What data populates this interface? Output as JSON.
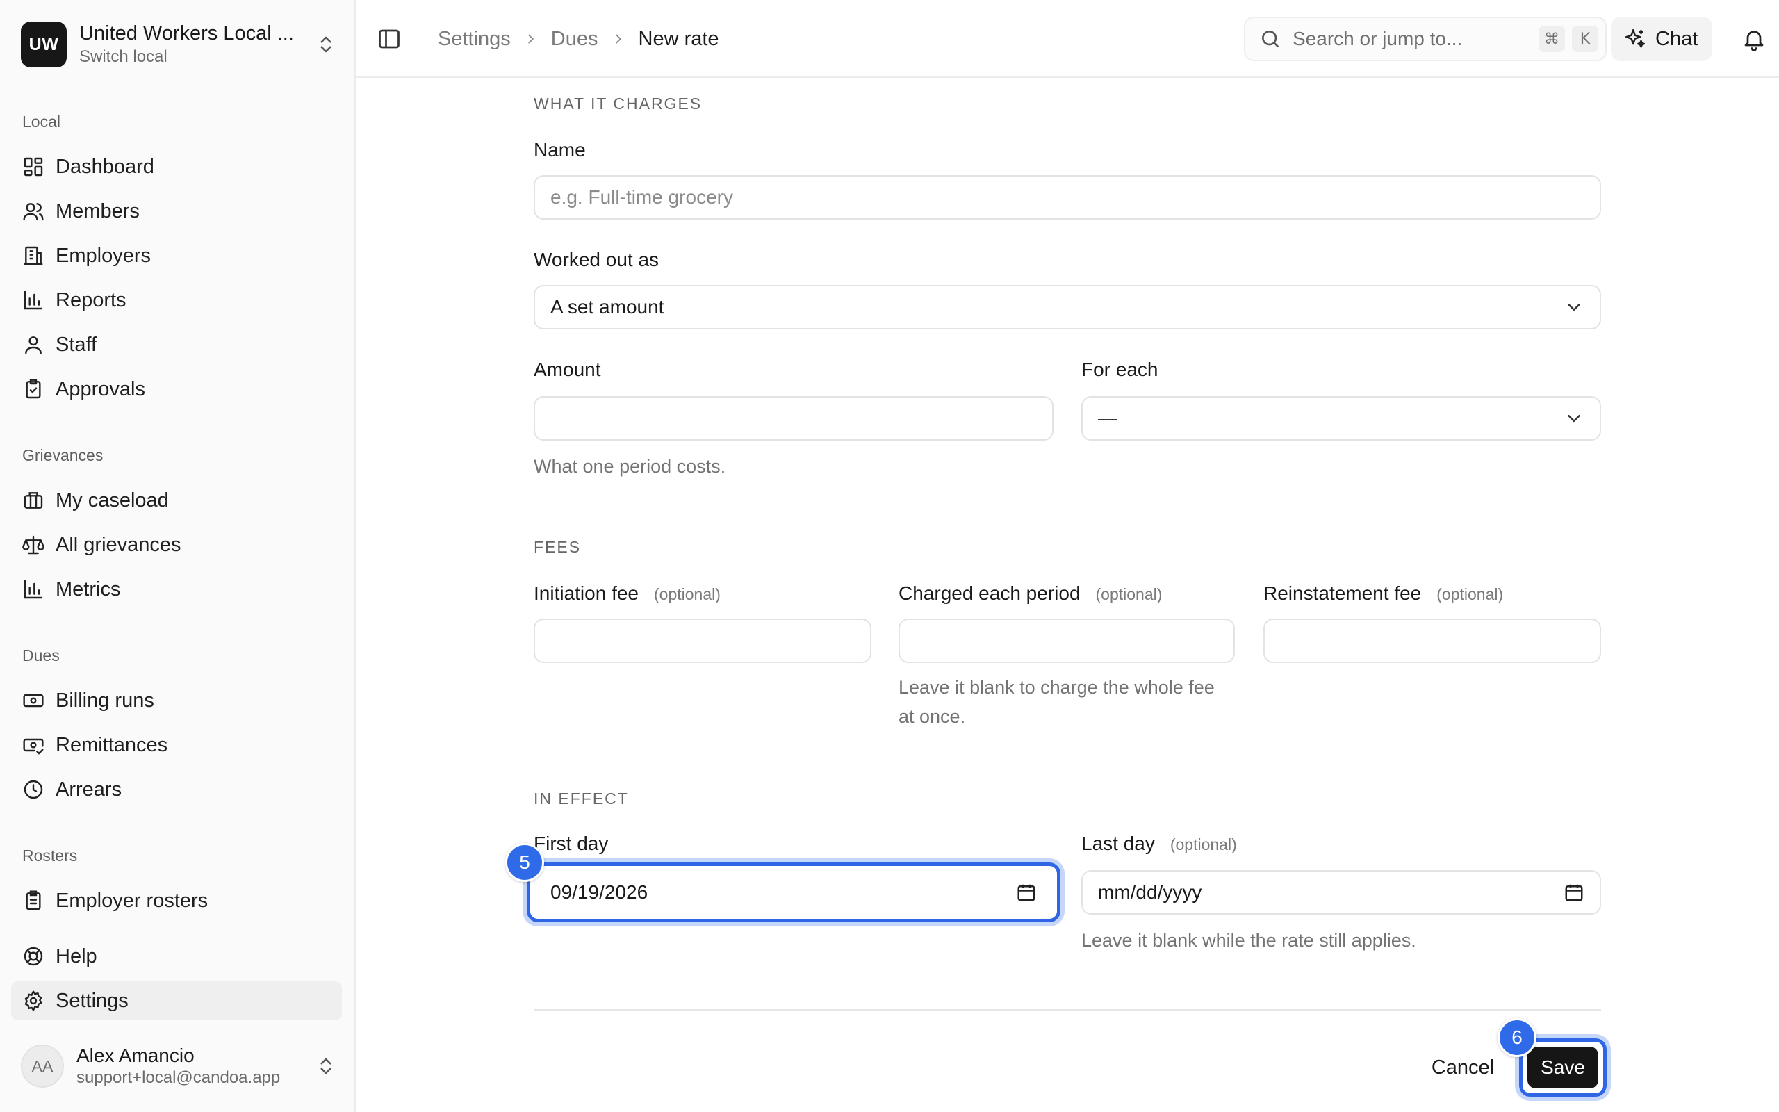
{
  "org": {
    "initials": "UW",
    "name": "United Workers Local ...",
    "subtitle": "Switch local"
  },
  "sidebar": {
    "sections": [
      {
        "label": "Local",
        "items": [
          "Dashboard",
          "Members",
          "Employers",
          "Reports",
          "Staff",
          "Approvals"
        ]
      },
      {
        "label": "Grievances",
        "items": [
          "My caseload",
          "All grievances",
          "Metrics"
        ]
      },
      {
        "label": "Dues",
        "items": [
          "Billing runs",
          "Remittances",
          "Arrears"
        ]
      },
      {
        "label": "Rosters",
        "items": [
          "Employer rosters"
        ]
      }
    ],
    "bottom_items": [
      "Help",
      "Settings"
    ],
    "active_item": "Settings"
  },
  "user": {
    "initials": "AA",
    "name": "Alex Amancio",
    "email": "support+local@candoa.app"
  },
  "breadcrumb": [
    "Settings",
    "Dues",
    "New rate"
  ],
  "search": {
    "placeholder": "Search or jump to...",
    "shortcut_mod": "⌘",
    "shortcut_key": "K"
  },
  "chat_label": "Chat",
  "form": {
    "section_charges": "WHAT IT CHARGES",
    "name_label": "Name",
    "name_placeholder": "e.g. Full-time grocery",
    "worked_out_label": "Worked out as",
    "worked_out_value": "A set amount",
    "amount_label": "Amount",
    "amount_value": "",
    "amount_help": "What one period costs.",
    "for_each_label": "For each",
    "for_each_value": "—",
    "section_fees": "FEES",
    "optional": "(optional)",
    "initiation_fee_label": "Initiation fee",
    "charged_each_period_label": "Charged each period",
    "charged_each_period_help": "Leave it blank to charge the whole fee at once.",
    "reinstatement_fee_label": "Reinstatement fee",
    "section_effect": "IN EFFECT",
    "first_day_label": "First day",
    "first_day_value": "09/19/2026",
    "last_day_label": "Last day",
    "last_day_placeholder": "mm/dd/yyyy",
    "last_day_help": "Leave it blank while the rate still applies.",
    "cancel_label": "Cancel",
    "save_label": "Save"
  },
  "step_badges": {
    "first_day": "5",
    "save": "6"
  },
  "colors": {
    "accent": "#2f66e6",
    "badge": "#2f6ae8",
    "primary_button": "#161616"
  }
}
